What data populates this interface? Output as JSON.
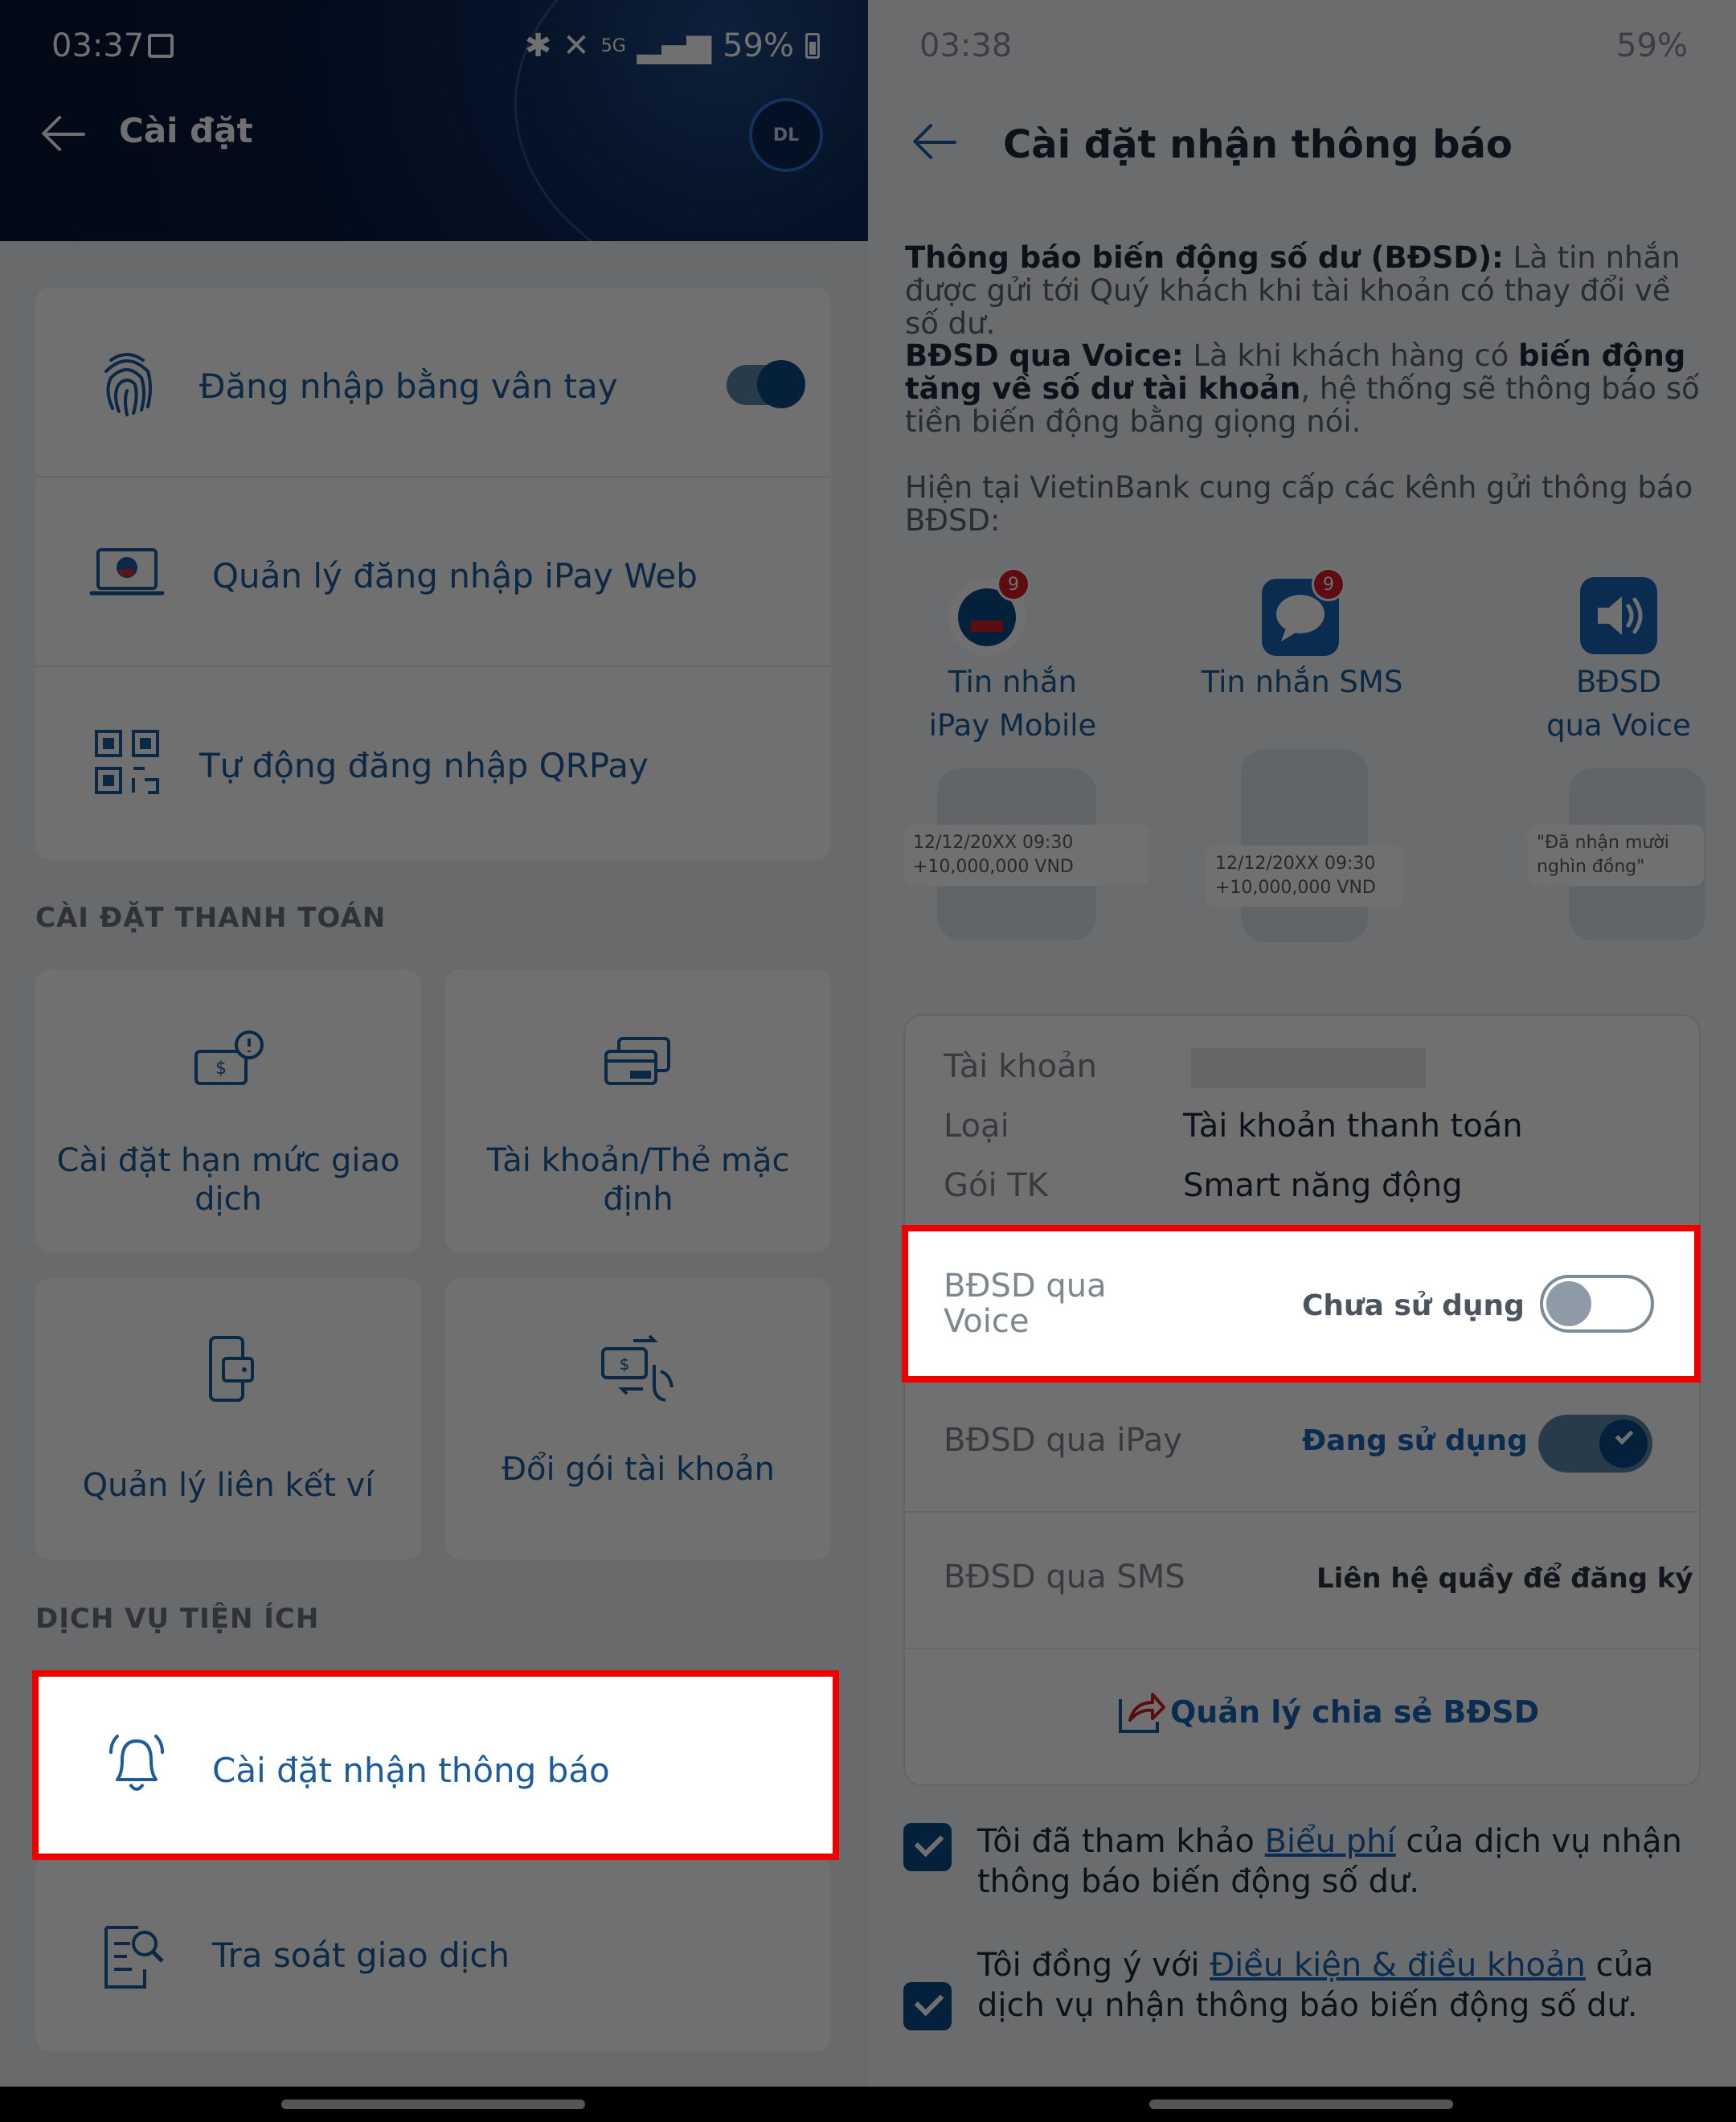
{
  "left": {
    "status": {
      "time": "03:37",
      "battery": "59%",
      "network": "5G"
    },
    "header": {
      "title": "Cài đặt",
      "avatar": "DL"
    },
    "security_items": [
      {
        "label": "Đăng nhập bằng vân tay",
        "icon": "fingerprint-icon",
        "toggle": true
      },
      {
        "label": "Quản lý đăng nhập iPay Web",
        "icon": "laptop-icon"
      },
      {
        "label": "Tự động đăng nhập QRPay",
        "icon": "qr-code-icon"
      }
    ],
    "payment_section": "CÀI ĐẶT THANH TOÁN",
    "payment_tiles": [
      {
        "label": "Cài đặt hạn mức giao dịch",
        "icon": "limit-icon"
      },
      {
        "label": "Tài khoản/Thẻ mặc định",
        "icon": "cards-icon"
      },
      {
        "label": "Quản lý liên kết ví",
        "icon": "wallet-icon"
      },
      {
        "label": "Đổi gói tài khoản",
        "icon": "exchange-icon"
      }
    ],
    "utility_section": "DỊCH VỤ TIỆN ÍCH",
    "utility_items": [
      {
        "label": "Cài đặt nhận thông báo",
        "icon": "bell-icon"
      },
      {
        "label": "Tra soát giao dịch",
        "icon": "search-doc-icon"
      }
    ]
  },
  "right": {
    "status": {
      "time": "03:38",
      "battery": "59%"
    },
    "title": "Cài đặt nhận thông báo",
    "para1_bold": "Thông báo biến động số dư (BĐSD):",
    "para1_rest": " Là tin nhắn được gửi tới Quý khách khi tài khoản có thay đổi về số dư.",
    "para2_bold1": "BĐSD qua Voice:",
    "para2_mid": " Là khi khách hàng có ",
    "para2_bold2": "biến động tăng về số dư tài khoản",
    "para2_rest": ", hệ thống sẽ thông báo số tiền biến động bằng giọng nói.",
    "para3": "Hiện tại VietinBank cung cấp các kênh gửi thông báo BĐSD:",
    "channels": [
      {
        "line1": "Tin nhắn",
        "line2": "iPay Mobile",
        "badge": "9"
      },
      {
        "line1": "Tin nhắn SMS",
        "line2": "",
        "badge": "9"
      },
      {
        "line1": "BĐSD",
        "line2": "qua Voice"
      }
    ],
    "bubbles": {
      "ipay_date": "12/12/20XX 09:30",
      "ipay_amount": "+10,000,000 VND",
      "sms_date": "12/12/20XX 09:30",
      "sms_amount": "+10,000,000 VND",
      "voice_text1": "\"Đã nhận mười",
      "voice_text2": "nghìn đồng\""
    },
    "account": {
      "k1": "Tài khoản",
      "k2": "Loại",
      "v2": "Tài khoản thanh toán",
      "k3": "Gói TK",
      "v3": "Smart năng động"
    },
    "subscriptions": [
      {
        "label1": "BĐSD qua",
        "label2": "Voice",
        "status": "Chưa sử dụng"
      },
      {
        "label1": "BĐSD qua iPay",
        "status": "Đang sử dụng"
      },
      {
        "label1": "BĐSD qua SMS",
        "status": "Liên hệ quầy để đăng ký"
      }
    ],
    "share_link": "Quản lý chia sẻ BĐSD",
    "agree1_pre": "Tôi đã tham khảo ",
    "agree1_link": "Biểu phí",
    "agree1_post": " của dịch vụ nhận thông báo biến động số dư.",
    "agree2_pre": "Tôi đồng ý với ",
    "agree2_link": "Điều kiện & điều khoản",
    "agree2_post": " của dịch vụ nhận thông báo biến động số dư.",
    "colors": {
      "accent": "#1a5c9c",
      "highlight": "#ee0000",
      "toggle": "#0c4a86"
    }
  }
}
